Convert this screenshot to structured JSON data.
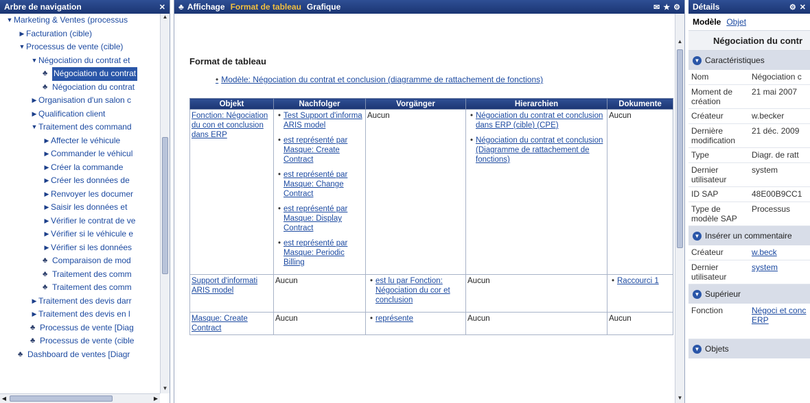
{
  "nav": {
    "title": "Arbre de navigation",
    "items": [
      {
        "label": "Marketing & Ventes (processus",
        "depth": 0,
        "type": "open"
      },
      {
        "label": "Facturation (cible)",
        "depth": 1,
        "type": "closed"
      },
      {
        "label": "Processus de vente (cible)",
        "depth": 1,
        "type": "open"
      },
      {
        "label": "Négociation du contrat et",
        "depth": 2,
        "type": "open"
      },
      {
        "label": "Négociation du contrat",
        "depth": 3,
        "type": "model",
        "selected": true
      },
      {
        "label": "Négociation du contrat",
        "depth": 3,
        "type": "model"
      },
      {
        "label": "Organisation d'un salon c",
        "depth": 2,
        "type": "closed"
      },
      {
        "label": "Qualification client",
        "depth": 2,
        "type": "closed"
      },
      {
        "label": "Traitement des command",
        "depth": 2,
        "type": "open"
      },
      {
        "label": "Affecter le véhicule",
        "depth": 3,
        "type": "closed"
      },
      {
        "label": "Commander le véhicul",
        "depth": 3,
        "type": "closed"
      },
      {
        "label": "Créer la commande",
        "depth": 3,
        "type": "closed"
      },
      {
        "label": "Créer les données de",
        "depth": 3,
        "type": "closed"
      },
      {
        "label": "Renvoyer les documer",
        "depth": 3,
        "type": "closed"
      },
      {
        "label": "Saisir les données et",
        "depth": 3,
        "type": "closed"
      },
      {
        "label": "Vérifier le contrat de ve",
        "depth": 3,
        "type": "closed"
      },
      {
        "label": "Vérifier si le véhicule e",
        "depth": 3,
        "type": "closed"
      },
      {
        "label": "Vérifier si les données",
        "depth": 3,
        "type": "closed"
      },
      {
        "label": "Comparaison de mod",
        "depth": 3,
        "type": "model"
      },
      {
        "label": "Traitement des comm",
        "depth": 3,
        "type": "model"
      },
      {
        "label": "Traitement des comm",
        "depth": 3,
        "type": "model"
      },
      {
        "label": "Traitement des devis darr",
        "depth": 2,
        "type": "closed"
      },
      {
        "label": "Traitement des devis en l",
        "depth": 2,
        "type": "closed"
      },
      {
        "label": "Processus de vente [Diag",
        "depth": 2,
        "type": "model"
      },
      {
        "label": "Processus de vente (cible",
        "depth": 2,
        "type": "model"
      },
      {
        "label": "Dashboard de ventes [Diagr",
        "depth": 1,
        "type": "model"
      }
    ]
  },
  "center": {
    "tabs": [
      "Affichage",
      "Format de tableau",
      "Grafique"
    ],
    "active_tab": "Format de tableau",
    "heading": "Format de tableau",
    "model_link": "Modèle: Négociation du contrat et conclusion (diagramme de rattachement de fonctions)",
    "columns": [
      "Objekt",
      "Nachfolger",
      "Vorgänger",
      "Hierarchien",
      "Dokumente"
    ],
    "rows": [
      {
        "objekt": "Fonction: Négociation du con et conclusion dans ERP",
        "nachfolger": [
          "Test Support d'informa ARIS model",
          "est représenté par Masque: Create Contract",
          "est représenté par Masque: Change Contract",
          "est représenté par Masque: Display Contract",
          "est représenté par Masque: Periodic Billing"
        ],
        "vorganger": "Aucun",
        "hierarchien": [
          "Négociation du contrat et conclusion dans ERP (cible) (CPE)",
          "Négociation du contrat et conclusion (Diagramme de rattachement de fonctions)"
        ],
        "dokumente": "Aucun"
      },
      {
        "objekt": "Support d'informati ARIS model",
        "nachfolger_text": "Aucun",
        "vorganger_list": [
          "est lu par Fonction: Négociation du cor et conclusion"
        ],
        "hierarchien_text": "Aucun",
        "dokumente_list": [
          "Raccourci 1"
        ]
      },
      {
        "objekt": "Masque: Create Contract",
        "nachfolger_text": "Aucun",
        "vorganger_list": [
          "représente"
        ],
        "hierarchien_text": "Aucun",
        "dokumente_text": "Aucun"
      }
    ]
  },
  "details": {
    "title": "Détails",
    "tab_model": "Modèle",
    "tab_object": "Objet",
    "object_title": "Négociation du contr",
    "sections": {
      "characteristics": "Caractéristiques",
      "comment": "Insérer un commentaire",
      "superior": "Supérieur",
      "objects": "Objets"
    },
    "properties": [
      {
        "key": "Nom",
        "value": "Négociation c"
      },
      {
        "key": "Moment de création",
        "value": "21 mai 2007"
      },
      {
        "key": "Créateur",
        "value": "w.becker"
      },
      {
        "key": "Dernière modification",
        "value": "21 déc. 2009"
      },
      {
        "key": "Type",
        "value": "Diagr. de ratt"
      },
      {
        "key": "Dernier utilisateur",
        "value": "system"
      },
      {
        "key": "ID SAP",
        "value": "48E00B9CC1"
      },
      {
        "key": "Type de modèle SAP",
        "value": "Processus"
      }
    ],
    "comment_rows": [
      {
        "key": "Créateur",
        "value": "w.beck"
      },
      {
        "key": "Dernier utilisateur",
        "value": "system"
      }
    ],
    "superior_row": {
      "key": "Fonction",
      "value": "Négoci et conc ERP"
    }
  }
}
